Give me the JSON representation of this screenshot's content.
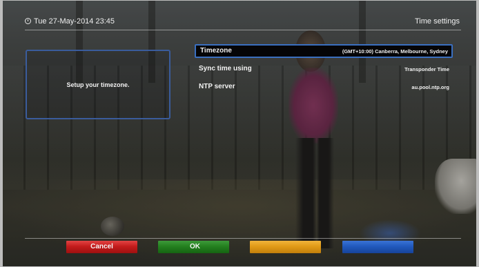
{
  "header": {
    "datetime": "Tue 27-May-2014 23:45",
    "title": "Time settings"
  },
  "help": {
    "text": "Setup your timezone."
  },
  "settings": [
    {
      "label": "Timezone",
      "value": "(GMT+10:00) Canberra, Melbourne, Sydney",
      "selected": true
    },
    {
      "label": "Sync time using",
      "value": "Transponder Time",
      "selected": false
    },
    {
      "label": "NTP server",
      "value": "au.pool.ntp.org",
      "selected": false
    }
  ],
  "footer": {
    "red_label": "Cancel",
    "green_label": "OK",
    "yellow_label": "",
    "blue_label": ""
  },
  "colors": {
    "highlight_border": "#3a6fc0",
    "red": "#c41c1c",
    "green": "#24801f",
    "yellow": "#e19a17",
    "blue": "#2159bd"
  }
}
